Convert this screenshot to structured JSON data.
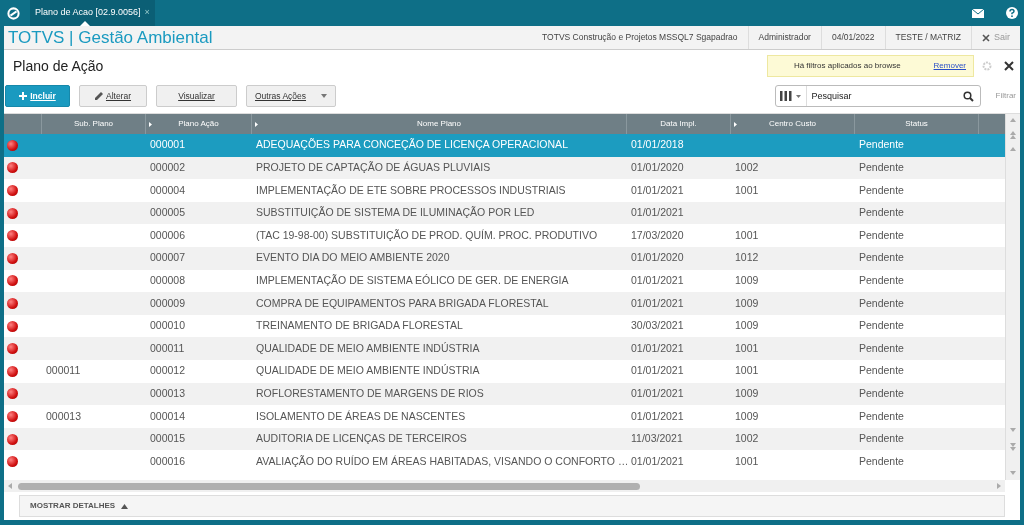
{
  "app_tab": {
    "label": "Plano de Acao [02.9.0056]",
    "close": "×"
  },
  "header": {
    "title": "TOTVS | Gestão Ambiental",
    "info": [
      "TOTVS Construção e Projetos MSSQL7 Sgapadrao",
      "Administrador",
      "04/01/2022",
      "TESTE / MATRIZ"
    ],
    "exit": "Sair"
  },
  "page_title": "Plano de Ação",
  "filter_notice": {
    "text": "Há filtros aplicados ao browse",
    "link": "Remover"
  },
  "toolbar": {
    "buttons": [
      {
        "label": "Incluir",
        "kind": "primary"
      },
      {
        "label": "Alterar",
        "kind": "edit"
      },
      {
        "label": "Visualizar",
        "kind": "plain"
      },
      {
        "label": "Outras Ações",
        "kind": "menu"
      }
    ],
    "search": {
      "placeholder": "Pesquisar"
    },
    "filter": "Filtrar"
  },
  "table": {
    "columns": [
      {
        "label": "Sub. Plano",
        "sortable": false
      },
      {
        "label": "Plano Ação",
        "sortable": true
      },
      {
        "label": "Nome Plano",
        "sortable": true
      },
      {
        "label": "Data Impl.",
        "sortable": false
      },
      {
        "label": "Centro Custo",
        "sortable": true
      },
      {
        "label": "Status",
        "sortable": false
      }
    ],
    "rows": [
      {
        "selected": true,
        "cells": [
          "",
          "000001",
          "ADEQUAÇÕES PARA CONCEÇÃO DE LICENÇA OPERACIONAL",
          "01/01/2018",
          "",
          "Pendente"
        ]
      },
      {
        "selected": false,
        "cells": [
          "",
          "000002",
          "PROJETO DE CAPTAÇÃO DE ÁGUAS PLUVIAIS",
          "01/01/2020",
          "1002",
          "Pendente"
        ]
      },
      {
        "selected": false,
        "cells": [
          "",
          "000004",
          "IMPLEMENTAÇÃO DE ETE SOBRE PROCESSOS INDUSTRIAIS",
          "01/01/2021",
          "1001",
          "Pendente"
        ]
      },
      {
        "selected": false,
        "cells": [
          "",
          "000005",
          "SUBSTITUIÇÃO DE SISTEMA DE ILUMINAÇÃO POR LED",
          "01/01/2021",
          "",
          "Pendente"
        ]
      },
      {
        "selected": false,
        "cells": [
          "",
          "000006",
          "(TAC 19-98-00) SUBSTITUIÇÃO DE PROD. QUÍM. PROC. PRODUTIVO",
          "17/03/2020",
          "1001",
          "Pendente"
        ]
      },
      {
        "selected": false,
        "cells": [
          "",
          "000007",
          "EVENTO DIA DO MEIO AMBIENTE 2020",
          "01/01/2020",
          "1012",
          "Pendente"
        ]
      },
      {
        "selected": false,
        "cells": [
          "",
          "000008",
          "IMPLEMENTAÇÃO DE SISTEMA EÓLICO DE GER. DE ENERGIA",
          "01/01/2021",
          "1009",
          "Pendente"
        ]
      },
      {
        "selected": false,
        "cells": [
          "",
          "000009",
          "COMPRA DE EQUIPAMENTOS PARA BRIGADA FLORESTAL",
          "01/01/2021",
          "1009",
          "Pendente"
        ]
      },
      {
        "selected": false,
        "cells": [
          "",
          "000010",
          "TREINAMENTO DE BRIGADA FLORESTAL",
          "30/03/2021",
          "1009",
          "Pendente"
        ]
      },
      {
        "selected": false,
        "cells": [
          "",
          "000011",
          "QUALIDADE DE MEIO AMBIENTE INDÚSTRIA",
          "01/01/2021",
          "1001",
          "Pendente"
        ]
      },
      {
        "selected": false,
        "cells": [
          "000011",
          "000012",
          "QUALIDADE DE MEIO AMBIENTE INDÚSTRIA",
          "01/01/2021",
          "1001",
          "Pendente"
        ]
      },
      {
        "selected": false,
        "cells": [
          "",
          "000013",
          "ROFLORESTAMENTO DE MARGENS DE RIOS",
          "01/01/2021",
          "1009",
          "Pendente"
        ]
      },
      {
        "selected": false,
        "cells": [
          "000013",
          "000014",
          "ISOLAMENTO DE ÁREAS DE NASCENTES",
          "01/01/2021",
          "1009",
          "Pendente"
        ]
      },
      {
        "selected": false,
        "cells": [
          "",
          "000015",
          "AUDITORIA DE LICENÇAS DE TERCEIROS",
          "11/03/2021",
          "1002",
          "Pendente"
        ]
      },
      {
        "selected": false,
        "cells": [
          "",
          "000016",
          "AVALIAÇÃO DO RUÍDO EM ÁREAS HABITADAS, VISANDO O CONFORTO …",
          "01/01/2021",
          "1001",
          "Pendente"
        ]
      }
    ]
  },
  "details_toggle": {
    "label": "MOSTRAR DETALHES",
    "expanded": false
  }
}
